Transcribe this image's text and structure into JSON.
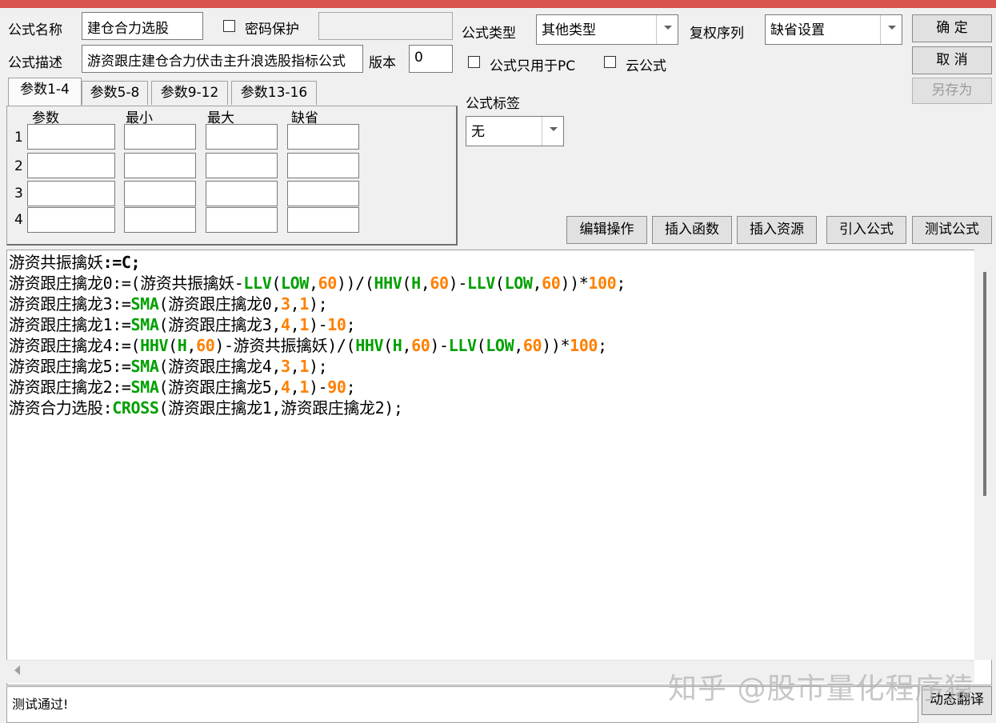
{
  "form": {
    "name_label": "公式名称",
    "name_value": "建仓合力选股",
    "password_label": "密码保护",
    "desc_label": "公式描述",
    "desc_value": "游资跟庄建仓合力伏击主升浪选股指标公式",
    "version_label": "版本",
    "version_value": "0",
    "type_label": "公式类型",
    "type_value": "其他类型",
    "rights_label": "复权序列",
    "rights_value": "缺省设置",
    "pc_only_label": "公式只用于PC",
    "cloud_label": "云公式",
    "tag_label": "公式标签",
    "tag_value": "无"
  },
  "buttons": {
    "ok": "确 定",
    "cancel": "取 消",
    "save_as": "另存为",
    "edit_ops": "编辑操作",
    "insert_func": "插入函数",
    "insert_res": "插入资源",
    "import_formula": "引入公式",
    "test_formula": "测试公式",
    "dynamic_translate": "动态翻译"
  },
  "tabs": [
    {
      "label": "参数1-4"
    },
    {
      "label": "参数5-8"
    },
    {
      "label": "参数9-12"
    },
    {
      "label": "参数13-16"
    }
  ],
  "params": {
    "headers": [
      "参数",
      "最小",
      "最大",
      "缺省"
    ],
    "rows": [
      "1",
      "2",
      "3",
      "4"
    ]
  },
  "code": [
    [
      [
        "t",
        "游资共振擒妖"
      ],
      [
        "o",
        ":=C;"
      ]
    ],
    [
      [
        "t",
        "游资跟庄擒龙0:=(游资共振擒妖-"
      ],
      [
        "k",
        "LLV"
      ],
      [
        "t",
        "("
      ],
      [
        "k",
        "LOW"
      ],
      [
        "t",
        ","
      ],
      [
        "n",
        "60"
      ],
      [
        "t",
        "))/("
      ],
      [
        "k",
        "HHV"
      ],
      [
        "t",
        "("
      ],
      [
        "k",
        "H"
      ],
      [
        "t",
        ","
      ],
      [
        "n",
        "60"
      ],
      [
        "t",
        ")-"
      ],
      [
        "k",
        "LLV"
      ],
      [
        "t",
        "("
      ],
      [
        "k",
        "LOW"
      ],
      [
        "t",
        ","
      ],
      [
        "n",
        "60"
      ],
      [
        "t",
        "))*"
      ],
      [
        "n",
        "100"
      ],
      [
        "t",
        ";"
      ]
    ],
    [
      [
        "t",
        "游资跟庄擒龙3:="
      ],
      [
        "k",
        "SMA"
      ],
      [
        "t",
        "(游资跟庄擒龙0,"
      ],
      [
        "n",
        "3"
      ],
      [
        "t",
        ","
      ],
      [
        "n",
        "1"
      ],
      [
        "t",
        ");"
      ]
    ],
    [
      [
        "t",
        "游资跟庄擒龙1:="
      ],
      [
        "k",
        "SMA"
      ],
      [
        "t",
        "(游资跟庄擒龙3,"
      ],
      [
        "n",
        "4"
      ],
      [
        "t",
        ","
      ],
      [
        "n",
        "1"
      ],
      [
        "t",
        ")-"
      ],
      [
        "n",
        "10"
      ],
      [
        "t",
        ";"
      ]
    ],
    [
      [
        "t",
        "游资跟庄擒龙4:=("
      ],
      [
        "k",
        "HHV"
      ],
      [
        "t",
        "("
      ],
      [
        "k",
        "H"
      ],
      [
        "t",
        ","
      ],
      [
        "n",
        "60"
      ],
      [
        "t",
        ")-游资共振擒妖)/("
      ],
      [
        "k",
        "HHV"
      ],
      [
        "t",
        "("
      ],
      [
        "k",
        "H"
      ],
      [
        "t",
        ","
      ],
      [
        "n",
        "60"
      ],
      [
        "t",
        ")-"
      ],
      [
        "k",
        "LLV"
      ],
      [
        "t",
        "("
      ],
      [
        "k",
        "LOW"
      ],
      [
        "t",
        ","
      ],
      [
        "n",
        "60"
      ],
      [
        "t",
        "))*"
      ],
      [
        "n",
        "100"
      ],
      [
        "t",
        ";"
      ]
    ],
    [
      [
        "t",
        "游资跟庄擒龙5:="
      ],
      [
        "k",
        "SMA"
      ],
      [
        "t",
        "(游资跟庄擒龙4,"
      ],
      [
        "n",
        "3"
      ],
      [
        "t",
        ","
      ],
      [
        "n",
        "1"
      ],
      [
        "t",
        ");"
      ]
    ],
    [
      [
        "t",
        "游资跟庄擒龙2:="
      ],
      [
        "k",
        "SMA"
      ],
      [
        "t",
        "(游资跟庄擒龙5,"
      ],
      [
        "n",
        "4"
      ],
      [
        "t",
        ","
      ],
      [
        "n",
        "1"
      ],
      [
        "t",
        ")-"
      ],
      [
        "n",
        "90"
      ],
      [
        "t",
        ";"
      ]
    ],
    [
      [
        "t",
        "游资合力选股:"
      ],
      [
        "k",
        "CROSS"
      ],
      [
        "t",
        "(游资跟庄擒龙1,游资跟庄擒龙2);"
      ]
    ]
  ],
  "status": "测试通过!",
  "watermark": "知乎 @股市量化程序猿",
  "colors": {
    "keyword": "#00a000",
    "number": "#ff8000",
    "titlebar": "#d9534f"
  }
}
